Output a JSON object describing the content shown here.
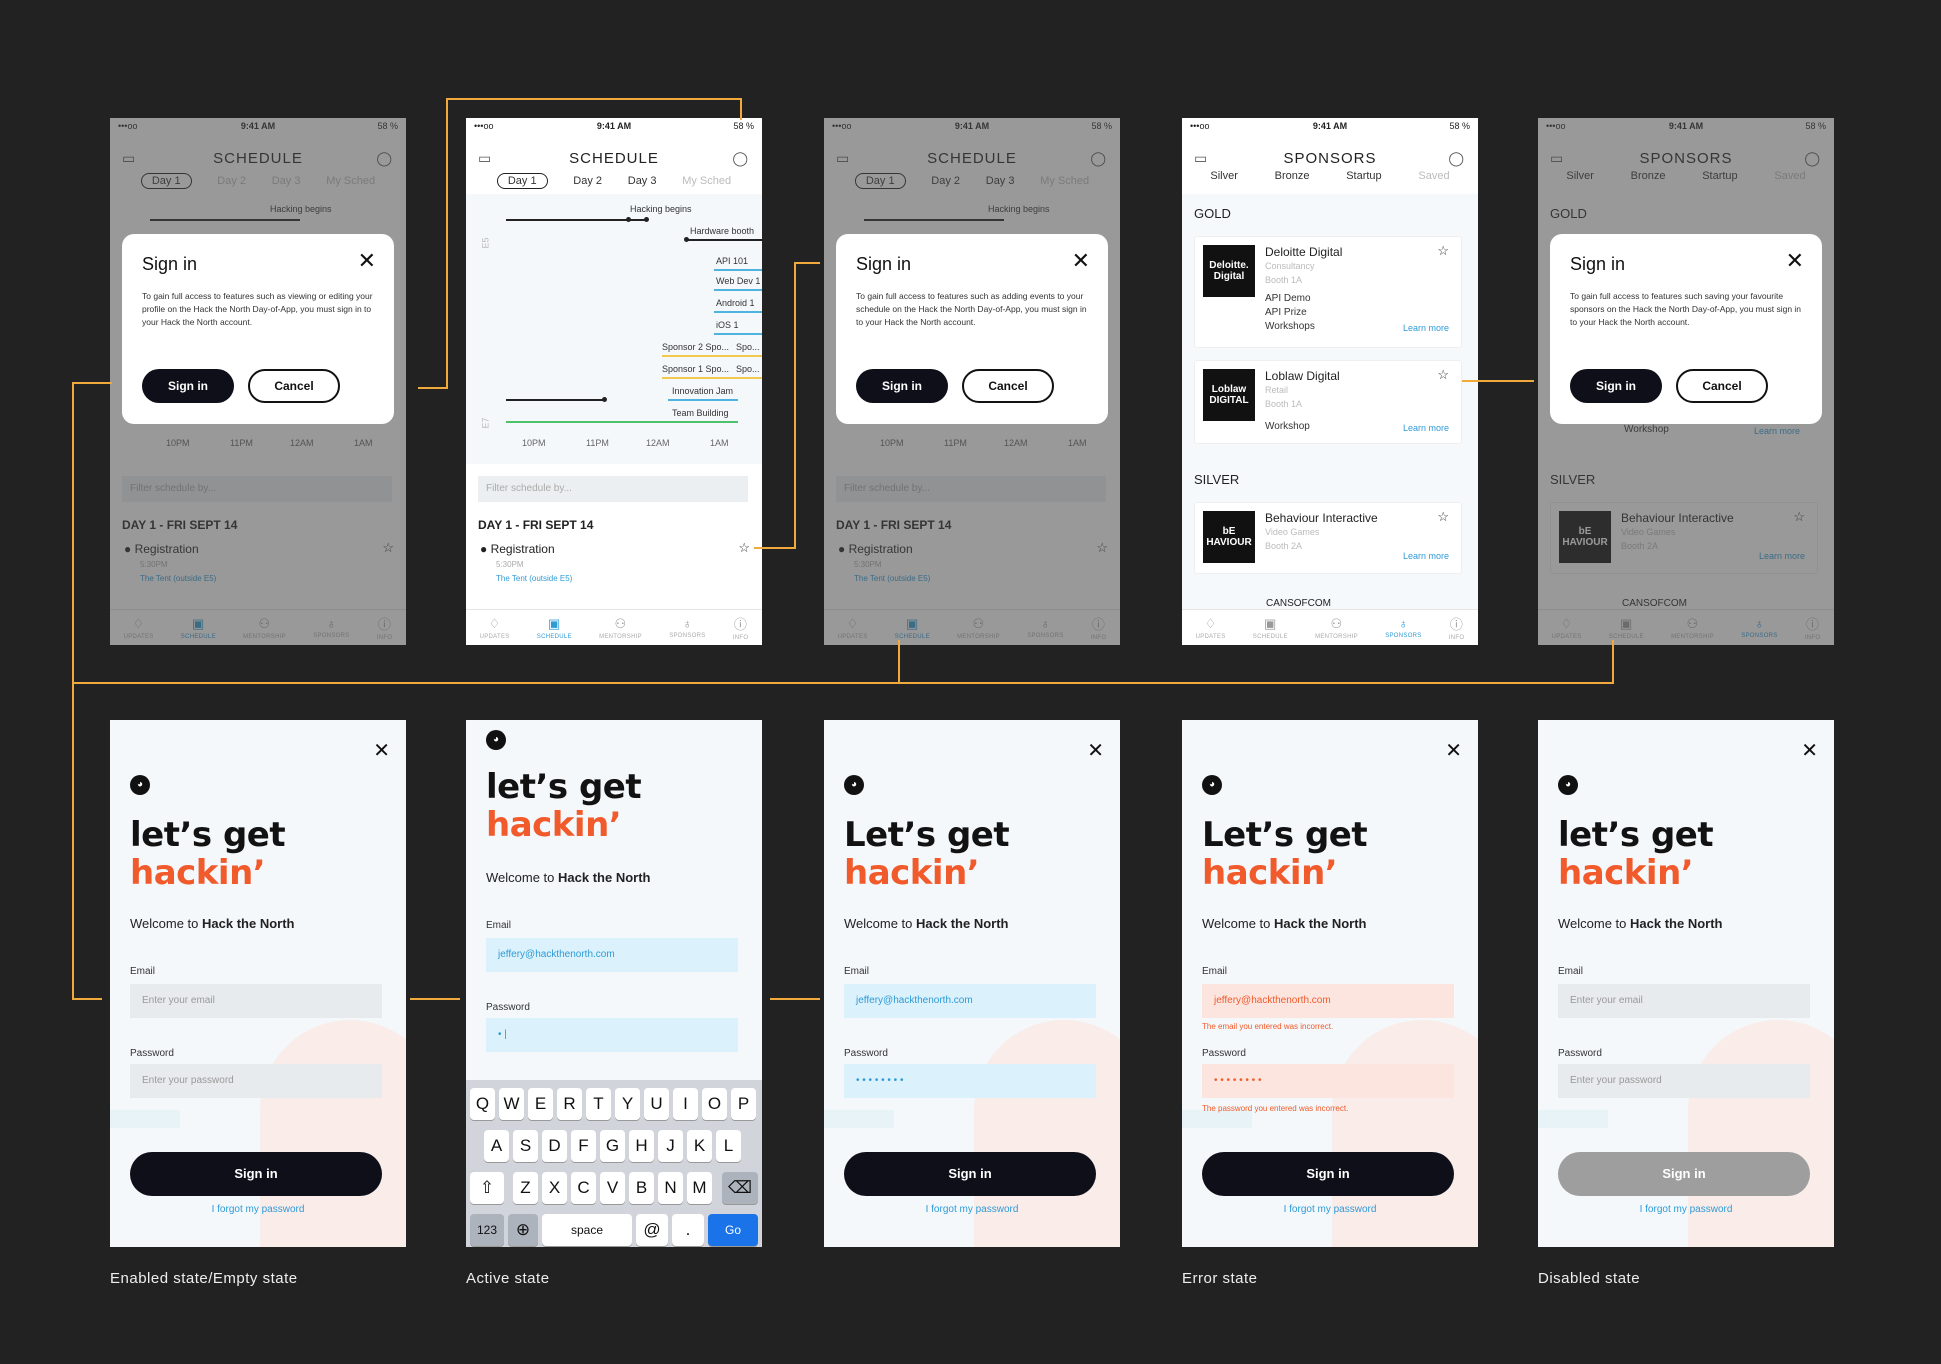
{
  "status_bar": {
    "time": "9:41 AM",
    "battery": "58 %",
    "signal": "•••oo"
  },
  "schedule": {
    "title": "SCHEDULE",
    "tabs": [
      "Day 1",
      "Day 2",
      "Day 3",
      "My Sched"
    ],
    "timeline_labels": [
      "Hacking begins",
      "Hardware booth",
      "API 101",
      "Web Dev 1",
      "Android 1",
      "iOS 1",
      "Sponsor 2 Spo...",
      "Spo...",
      "Sponsor 1 Spo...",
      "Spo...",
      "Innovation Jam",
      "Team Building"
    ],
    "building_labels": [
      "E5",
      "E7"
    ],
    "times": [
      "10PM",
      "11PM",
      "12AM",
      "1AM"
    ],
    "filter_placeholder": "Filter schedule by...",
    "day_heading": "DAY 1 - FRI SEPT 14",
    "event": {
      "name": "Registration",
      "time": "5:30PM",
      "location": "The Tent (outside E5)"
    }
  },
  "sponsors": {
    "title": "SPONSORS",
    "tabs": [
      "Silver",
      "Bronze",
      "Startup",
      "Saved"
    ],
    "sections": {
      "gold": "GOLD",
      "silver": "SILVER"
    },
    "cards": [
      {
        "logo": "Deloitte. Digital",
        "name": "Deloitte Digital",
        "category": "Consultancy",
        "booth": "Booth 1A",
        "items": [
          "API Demo",
          "API Prize",
          "Workshops"
        ],
        "link": "Learn more"
      },
      {
        "logo": "Loblaw DIGITAL",
        "name": "Loblaw Digital",
        "category": "Retail",
        "booth": "Booth 1A",
        "items": [
          "Workshop"
        ],
        "link": "Learn more"
      },
      {
        "logo": "bE HAVIOUR",
        "name": "Behaviour Interactive",
        "category": "Video Games",
        "booth": "Booth 2A",
        "items": [],
        "link": "Learn more"
      }
    ],
    "next_card_partial": "CANSOFCOM"
  },
  "nav": [
    "UPDATES",
    "SCHEDULE",
    "MENTORSHIP",
    "SPONSORS",
    "INFO"
  ],
  "modal": {
    "title": "Sign in",
    "body_schedule": "To gain full access to features such as viewing or editing your profile on the Hack the North Day-of-App, you must sign in to your Hack the North account.",
    "body_events": "To gain full access to features such as adding events to your schedule on the Hack the North Day-of-App, you must sign in to your Hack the North account.",
    "body_sponsors": "To gain full access to features such saving your favourite sponsors on the Hack the North Day-of-App, you must sign in to your Hack the North account.",
    "signin": "Sign in",
    "cancel": "Cancel"
  },
  "login": {
    "heading_lower": "let’s get",
    "heading_upper": "Let’s get",
    "heading_accent": "hackin’",
    "welcome_prefix": "Welcome to ",
    "welcome_bold": "Hack the North",
    "email_label": "Email",
    "password_label": "Password",
    "email_placeholder": "Enter your email",
    "password_placeholder": "Enter your password",
    "email_value": "jeffery@hackthenorth.com",
    "password_dots": "• • • • • • • •",
    "email_error": "The email you entered was incorrect.",
    "password_error": "The password you entered was incorrect.",
    "signin": "Sign in",
    "forgot": "I forgot my password"
  },
  "keyboard": {
    "row1": [
      "Q",
      "W",
      "E",
      "R",
      "T",
      "Y",
      "U",
      "I",
      "O",
      "P"
    ],
    "row2": [
      "A",
      "S",
      "D",
      "F",
      "G",
      "H",
      "J",
      "K",
      "L"
    ],
    "row3": [
      "Z",
      "X",
      "C",
      "V",
      "B",
      "N",
      "M"
    ],
    "num": "123",
    "space": "space",
    "at": "@",
    "dot": ".",
    "go": "Go"
  },
  "captions": [
    "Enabled state/Empty state",
    "Active state",
    "Error state",
    "Disabled state"
  ],
  "colors": {
    "accent": "#f15a2b",
    "link": "#2f9bd6",
    "connector": "#f2a93b",
    "button": "#0f0f1a"
  }
}
